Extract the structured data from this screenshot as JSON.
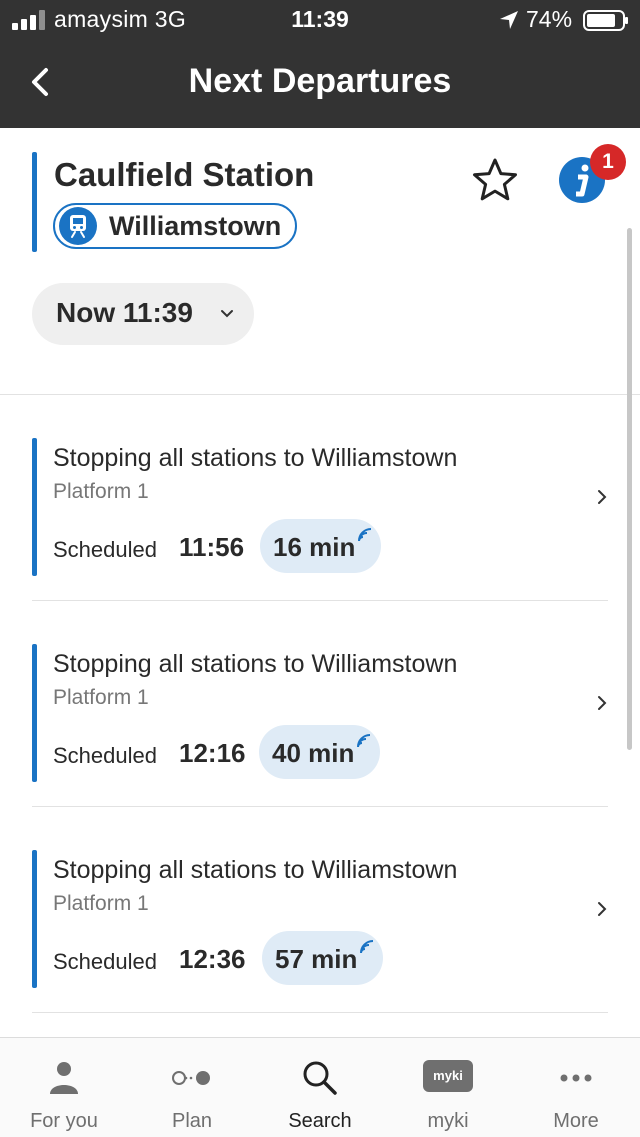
{
  "status_bar": {
    "carrier": "amaysim  3G",
    "time": "11:39",
    "battery": "74%"
  },
  "header": {
    "title": "Next Departures"
  },
  "station": {
    "name": "Caulfield Station",
    "route": "Williamstown",
    "alert_count": "1",
    "time_filter": "Now 11:39"
  },
  "departures": [
    {
      "title": "Stopping all stations to Williamstown",
      "platform": "Platform 1",
      "scheduled_label": "Scheduled",
      "time": "11:56",
      "minutes": "16 min"
    },
    {
      "title": "Stopping all stations to Williamstown",
      "platform": "Platform 1",
      "scheduled_label": "Scheduled",
      "time": "12:16",
      "minutes": "40 min"
    },
    {
      "title": "Stopping all stations to Williamstown",
      "platform": "Platform 1",
      "scheduled_label": "Scheduled",
      "time": "12:36",
      "minutes": "57 min"
    }
  ],
  "tabs": [
    {
      "label": "For you",
      "icon": "person-icon"
    },
    {
      "label": "Plan",
      "icon": "route-icon"
    },
    {
      "label": "Search",
      "icon": "search-icon",
      "active": true
    },
    {
      "label": "myki",
      "icon": "myki-card-icon",
      "badge": "myki"
    },
    {
      "label": "More",
      "icon": "more-icon"
    }
  ],
  "colors": {
    "header_bg": "#333333",
    "accent": "#1a73c4",
    "badge": "#d62828",
    "minutes_pill": "#dfebf6"
  }
}
